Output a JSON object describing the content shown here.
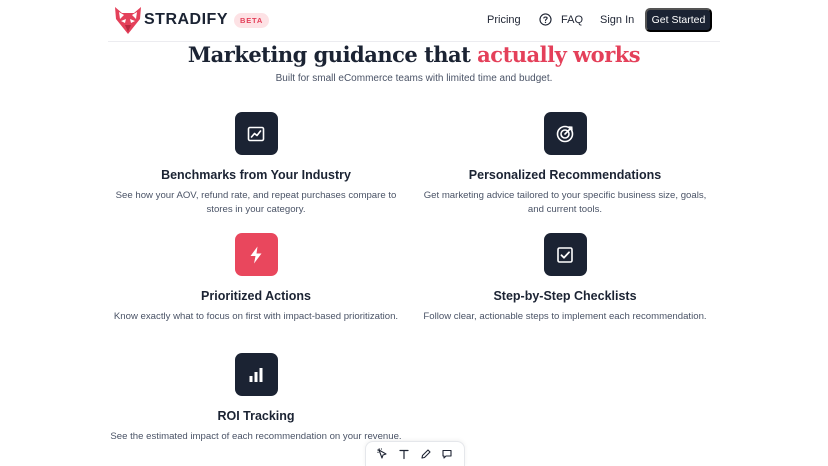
{
  "brand": {
    "name": "STRADIFY",
    "badge": "BETA",
    "accent": "#e4405a",
    "dark": "#1b2333"
  },
  "nav": {
    "pricing": "Pricing",
    "faq": "FAQ",
    "sign_in": "Sign In",
    "cta": "Get Started"
  },
  "hero": {
    "title_main": "Marketing guidance that ",
    "title_accent": "actually works",
    "subtitle": "Built for small eCommerce teams with limited time and budget."
  },
  "features": [
    {
      "icon": "chart-line-icon",
      "title": "Benchmarks from Your Industry",
      "description": "See how your AOV, refund rate, and repeat purchases compare to stores in your category."
    },
    {
      "icon": "target-icon",
      "title": "Personalized Recommendations",
      "description": "Get marketing advice tailored to your specific business size, goals, and current tools."
    },
    {
      "icon": "lightning-icon",
      "title": "Prioritized Actions",
      "description": "Know exactly what to focus on first with impact-based prioritization."
    },
    {
      "icon": "checkbox-icon",
      "title": "Step-by-Step Checklists",
      "description": "Follow clear, actionable steps to implement each recommendation."
    },
    {
      "icon": "bar-chart-icon",
      "title": "ROI Tracking",
      "description": "See the estimated impact of each recommendation on your revenue."
    }
  ],
  "toolbar": {
    "tools": [
      "select-tool-icon",
      "text-tool-icon",
      "pen-tool-icon",
      "comment-tool-icon"
    ]
  }
}
